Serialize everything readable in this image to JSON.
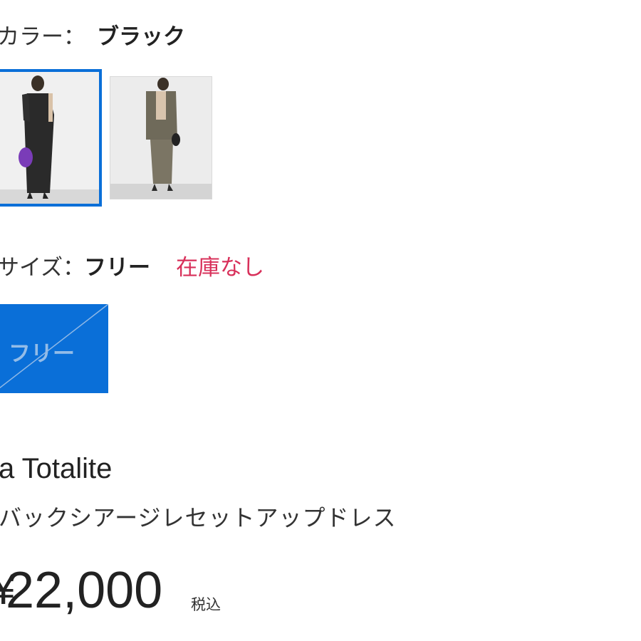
{
  "color": {
    "label": "カラー：",
    "value": "ブラック",
    "swatches": [
      {
        "name": "black-swatch",
        "selected": true,
        "tone": "#2b2b2b"
      },
      {
        "name": "khaki-swatch",
        "selected": false,
        "tone": "#6f6a5a"
      }
    ]
  },
  "size": {
    "label": "サイズ：",
    "value": "フリー",
    "stock_status": "在庫なし",
    "options": [
      "フリー"
    ]
  },
  "product": {
    "brand": "a Totalite",
    "name": "バックシアージレセットアップドレス",
    "price_symbol": "¥",
    "price": "22,000",
    "tax_label": "税込"
  },
  "colors": {
    "accent": "#0a6fd8",
    "stock_out": "#d8305a"
  }
}
